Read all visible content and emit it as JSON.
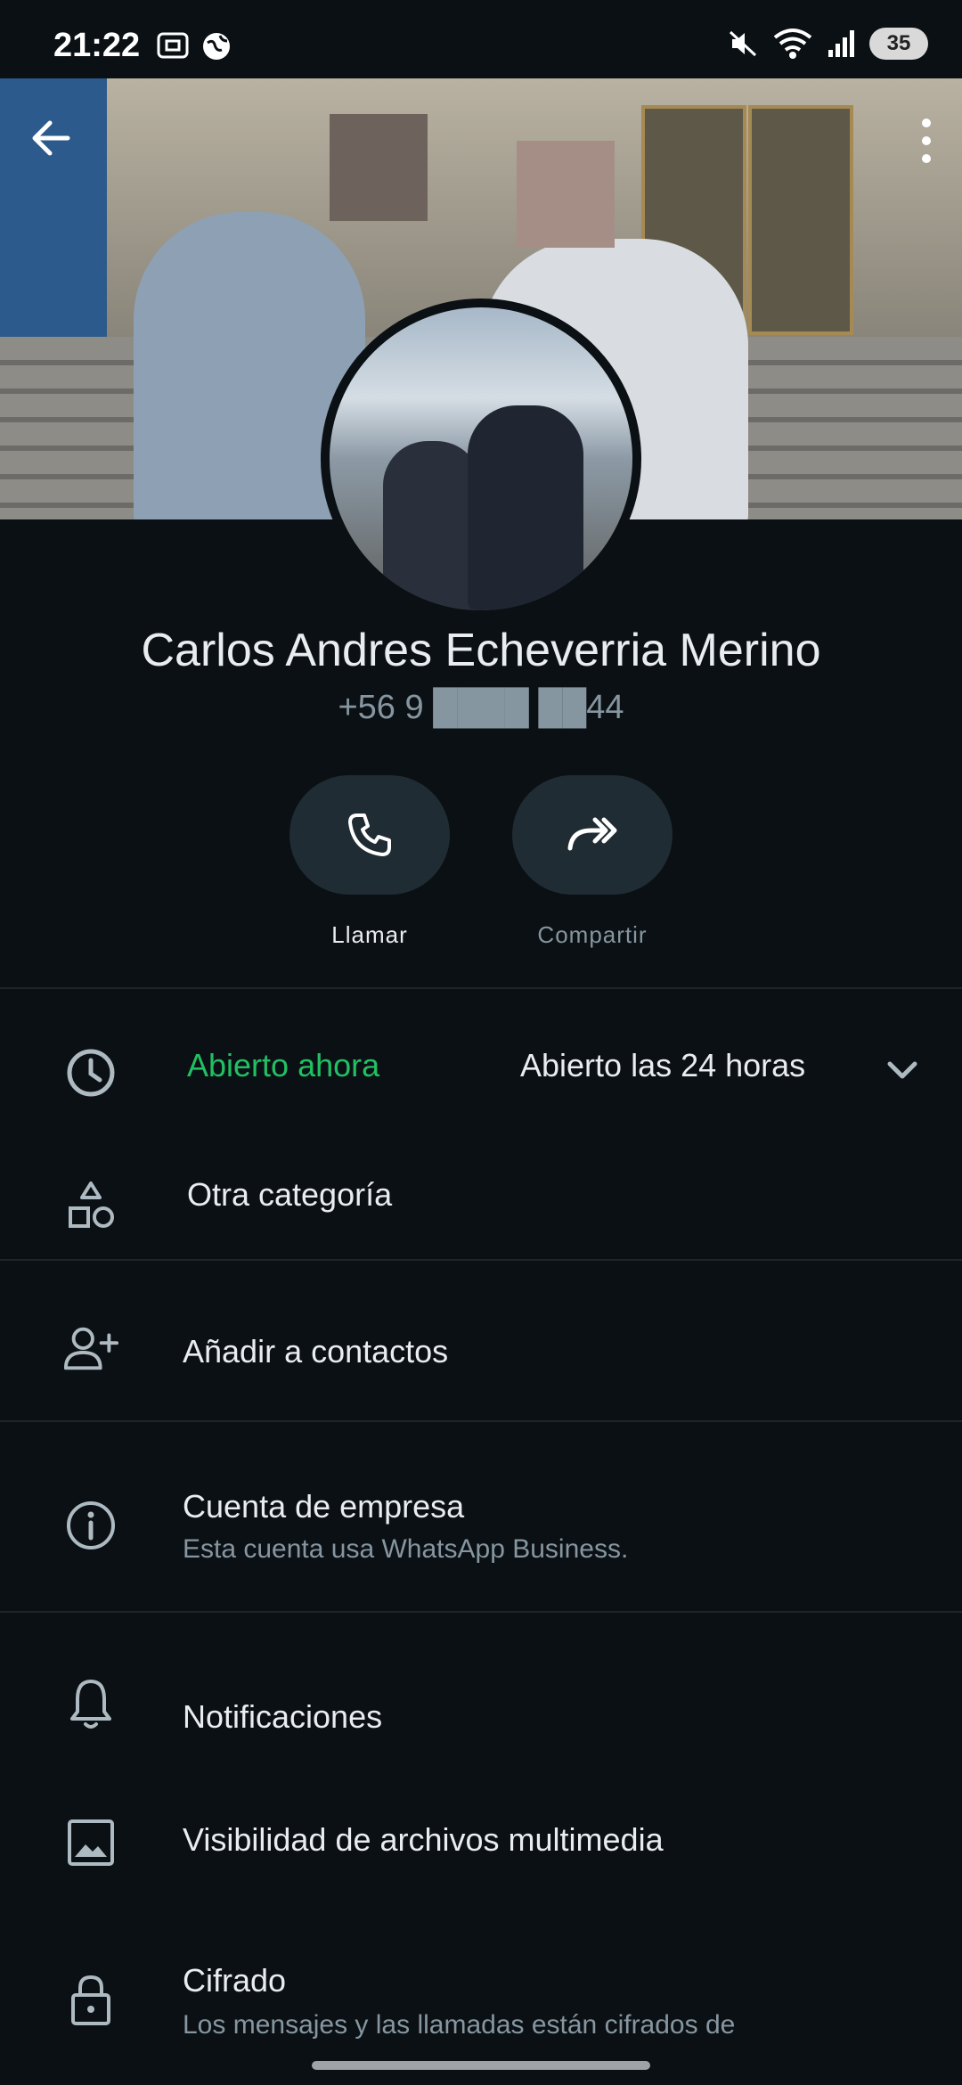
{
  "status_bar": {
    "time": "21:22",
    "battery": "35",
    "icons": [
      "screenshot-icon",
      "globe-icon",
      "mute-icon",
      "wifi-icon",
      "signal-icon"
    ]
  },
  "header": {
    "back_icon": "arrow-left-icon",
    "menu_icon": "more-vert-icon"
  },
  "profile": {
    "name": "Carlos Andres Echeverria Merino",
    "phone": "+56 9 ████ ██44"
  },
  "actions": [
    {
      "label": "Llamar",
      "icon": "phone-icon"
    },
    {
      "label": "Compartir",
      "icon": "share-forward-icon"
    }
  ],
  "hours": {
    "status": "Abierto ahora",
    "schedule": "Abierto las 24 horas",
    "icon": "clock-icon"
  },
  "rows": {
    "category": {
      "title": "Otra categoría",
      "icon": "shapes-icon"
    },
    "add_contact": {
      "title": "Añadir a contactos",
      "icon": "add-person-icon"
    },
    "business": {
      "title": "Cuenta de empresa",
      "subtitle": "Esta cuenta usa WhatsApp Business.",
      "icon": "info-icon"
    },
    "notifications": {
      "title": "Notificaciones",
      "icon": "bell-icon"
    },
    "media": {
      "title": "Visibilidad de archivos multimedia",
      "icon": "image-icon"
    },
    "encryption": {
      "title": "Cifrado",
      "subtitle": "Los mensajes y las llamadas están cifrados de",
      "icon": "lock-icon"
    }
  },
  "colors": {
    "background": "#0b1014",
    "accent_green": "#21c063",
    "secondary_text": "#8696a0",
    "button_bg": "#202c33"
  }
}
